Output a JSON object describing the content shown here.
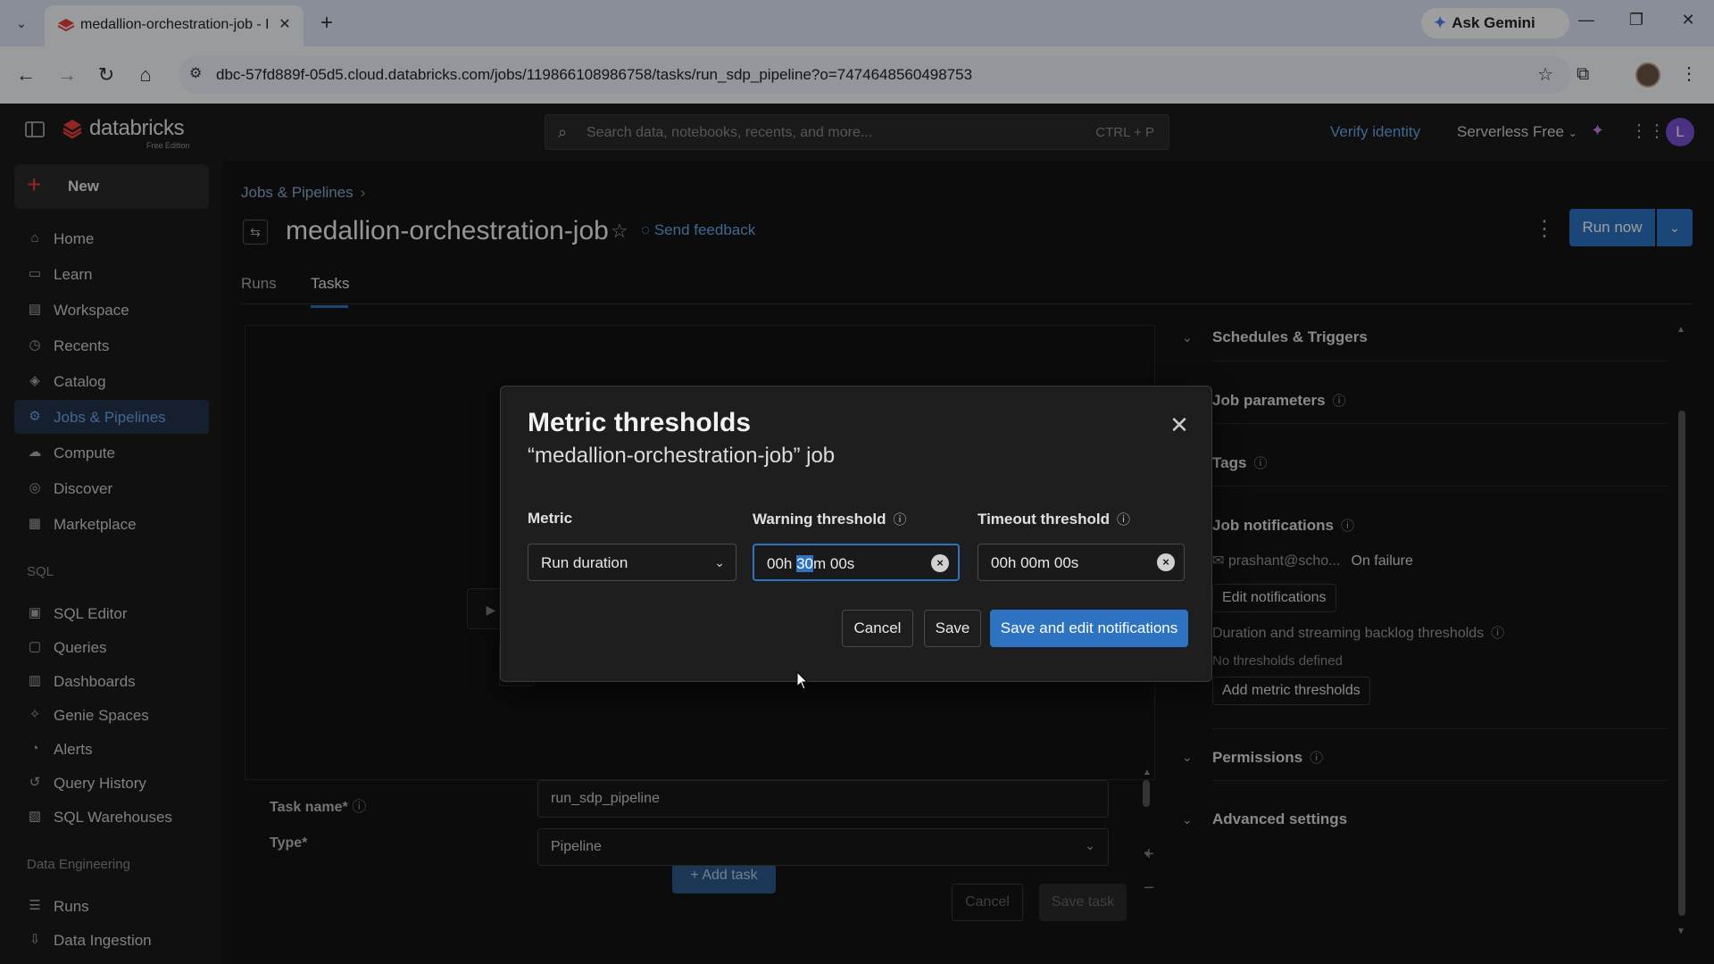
{
  "browser": {
    "tab_title": "medallion-orchestration-job - D",
    "tab_close": "✕",
    "new_tab": "+",
    "ask_gemini": "Ask Gemini",
    "url": "dbc-57fd889f-05d5.cloud.databricks.com/jobs/119866108986758/tasks/run_sdp_pipeline?o=7474648560498753"
  },
  "header": {
    "brand": "databricks",
    "edition": "Free Edition",
    "search_placeholder": "Search data, notebooks, recents, and more...",
    "search_shortcut": "CTRL + P",
    "verify_identity": "Verify identity",
    "workspace": "Serverless Free",
    "user_initial": "L"
  },
  "sidebar": {
    "new_label": "New",
    "items": [
      {
        "label": "Home",
        "icon": "⌂"
      },
      {
        "label": "Learn",
        "icon": "▭"
      },
      {
        "label": "Workspace",
        "icon": "▤"
      },
      {
        "label": "Recents",
        "icon": "◷"
      },
      {
        "label": "Catalog",
        "icon": "◈"
      },
      {
        "label": "Jobs & Pipelines",
        "icon": "⚙"
      },
      {
        "label": "Compute",
        "icon": "☁"
      },
      {
        "label": "Discover",
        "icon": "◎"
      },
      {
        "label": "Marketplace",
        "icon": "▦"
      }
    ],
    "sql_section": "SQL",
    "sql_items": [
      {
        "label": "SQL Editor",
        "icon": "▣"
      },
      {
        "label": "Queries",
        "icon": "▢"
      },
      {
        "label": "Dashboards",
        "icon": "▥"
      },
      {
        "label": "Genie Spaces",
        "icon": "✧"
      },
      {
        "label": "Alerts",
        "icon": "◔"
      },
      {
        "label": "Query History",
        "icon": "↺"
      },
      {
        "label": "SQL Warehouses",
        "icon": "▧"
      }
    ],
    "de_section": "Data Engineering",
    "de_items": [
      {
        "label": "Runs",
        "icon": "☰"
      },
      {
        "label": "Data Ingestion",
        "icon": "⇩"
      }
    ]
  },
  "page": {
    "breadcrumb": "Jobs & Pipelines",
    "title": "medallion-orchestration-job",
    "send_feedback": "Send feedback",
    "run_now": "Run now",
    "tabs": [
      "Runs",
      "Tasks"
    ]
  },
  "canvas": {
    "add_task": "+ Add task",
    "zoom_in": "+",
    "zoom_out": "−"
  },
  "task_form": {
    "task_name_label": "Task name*",
    "task_name_value": "run_sdp_pipeline",
    "type_label": "Type*",
    "type_value": "Pipeline",
    "cancel": "Cancel",
    "save_task": "Save task"
  },
  "right_panel": {
    "schedules": "Schedules & Triggers",
    "job_parameters": "Job parameters",
    "tags": "Tags",
    "job_notifications": "Job notifications",
    "notif_email": "prashant@scho...",
    "notif_when": "On failure",
    "edit_notifications": "Edit notifications",
    "thresholds_heading": "Duration and streaming backlog thresholds",
    "no_thresholds": "No thresholds defined",
    "add_metric_thresholds": "Add metric thresholds",
    "permissions": "Permissions",
    "advanced": "Advanced settings"
  },
  "modal": {
    "title": "Metric thresholds",
    "subtitle": "“medallion-orchestration-job” job",
    "metric_label": "Metric",
    "metric_value": "Run duration",
    "warning_label": "Warning threshold",
    "warning_pre": "00h ",
    "warning_sel": "30",
    "warning_post": "m 00s",
    "timeout_label": "Timeout threshold",
    "timeout_value": "00h 00m 00s",
    "cancel": "Cancel",
    "save": "Save",
    "save_and_edit": "Save and edit notifications"
  },
  "colors": {
    "accent": "#2d73c2",
    "link": "#6aa6e8",
    "brand_red": "#e8403a"
  }
}
